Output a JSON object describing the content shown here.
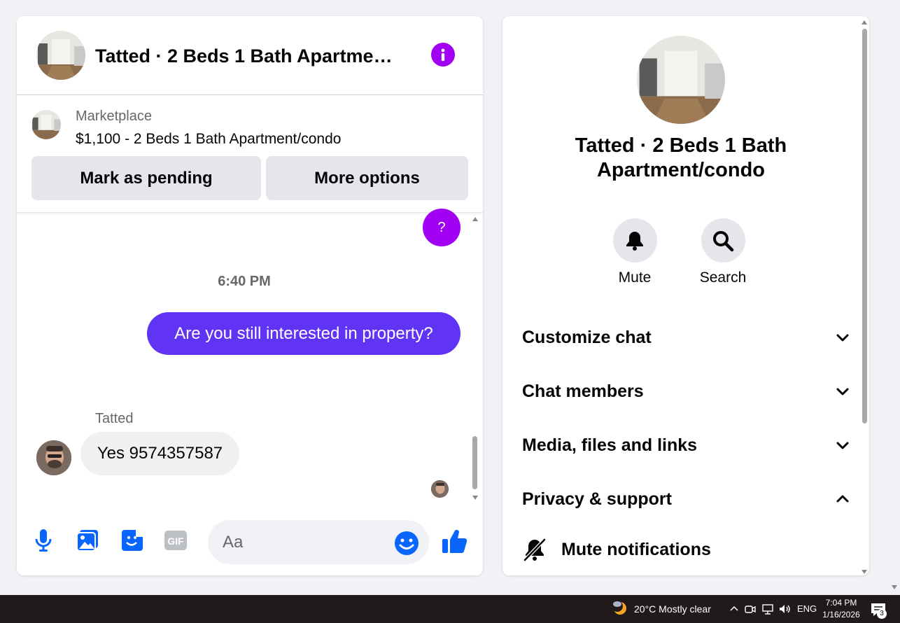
{
  "chat": {
    "title": "Tatted · 2 Beds 1 Bath Apartment/condo",
    "marketplace_label": "Marketplace",
    "listing": "$1,100 - 2 Beds 1 Bath Apartment/condo",
    "mark_pending_label": "Mark as pending",
    "more_options_label": "More options",
    "prev_bubble_text": "?",
    "timestamp": "6:40 PM",
    "outgoing_message": "Are you still interested in property?",
    "sender_name": "Tatted",
    "incoming_message": "Yes 9574357587",
    "composer_placeholder": "Aa",
    "accent_color": "#a100f2",
    "outgoing_color": "#6033f5",
    "icons": [
      "info-icon",
      "microphone-icon",
      "image-icon",
      "sticker-icon",
      "gif-icon",
      "emoji-icon",
      "thumbs-up-icon"
    ]
  },
  "info_panel": {
    "title": "Tatted · 2 Beds 1 Bath Apartment/condo",
    "mute_label": "Mute",
    "search_label": "Search",
    "sections": [
      {
        "label": "Customize chat",
        "expanded": false
      },
      {
        "label": "Chat members",
        "expanded": false
      },
      {
        "label": "Media, files and links",
        "expanded": false
      },
      {
        "label": "Privacy & support",
        "expanded": true
      }
    ],
    "mute_notifications_label": "Mute notifications"
  },
  "taskbar": {
    "weather": "20°C  Mostly clear",
    "language": "ENG",
    "time": "7:04 PM",
    "date": "1/16/2026",
    "notification_count": "3"
  }
}
